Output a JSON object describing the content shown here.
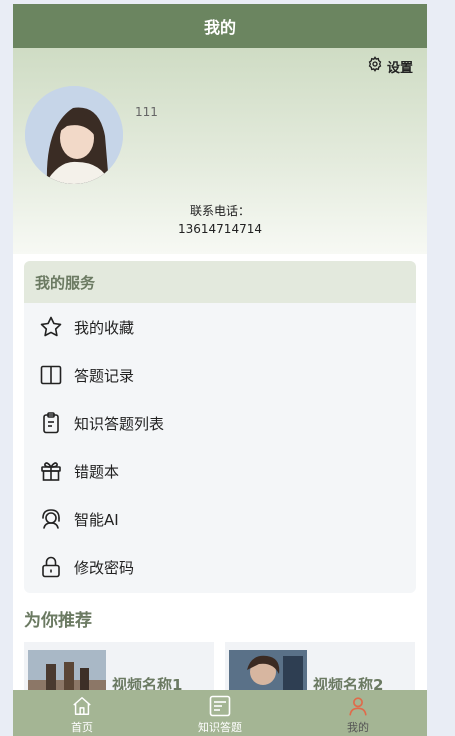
{
  "header": {
    "title": "我的"
  },
  "profile": {
    "settings_label": "设置",
    "username": "111",
    "phone_label": "联系电话：",
    "phone_number": "13614714714"
  },
  "services": {
    "title": "我的服务",
    "items": [
      {
        "label": "我的收藏",
        "icon": "star-icon"
      },
      {
        "label": "答题记录",
        "icon": "book-icon"
      },
      {
        "label": "知识答题列表",
        "icon": "clipboard-icon"
      },
      {
        "label": "错题本",
        "icon": "gift-icon"
      },
      {
        "label": "智能AI",
        "icon": "ai-assistant-icon"
      },
      {
        "label": "修改密码",
        "icon": "lock-icon"
      }
    ]
  },
  "recommend": {
    "title": "为你推荐",
    "videos": [
      {
        "name": "视频名称1"
      },
      {
        "name": "视频名称2"
      }
    ]
  },
  "tabbar": {
    "items": [
      {
        "label": "首页",
        "icon": "home-icon"
      },
      {
        "label": "知识答题",
        "icon": "quiz-icon"
      },
      {
        "label": "我的",
        "icon": "user-icon"
      }
    ],
    "active_index": 2
  },
  "colors": {
    "brand": "#6b8560",
    "tabbar": "#a4b594",
    "accent_text": "#6b7a62",
    "active_tab_icon": "#e06a4a"
  }
}
